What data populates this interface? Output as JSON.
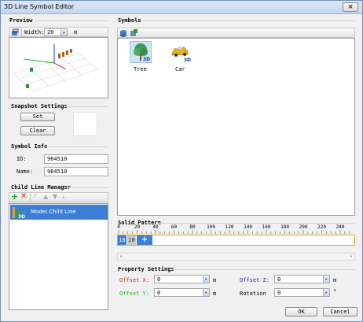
{
  "window": {
    "title": "3D Line Symbol Editor",
    "close_glyph": "×"
  },
  "preview": {
    "label": "Preview",
    "width_label": "Width:",
    "width_value": "20",
    "width_unit": "m"
  },
  "snapshot": {
    "label": "Snapshot Settings",
    "set_label": "Set",
    "clear_label": "Clear"
  },
  "symbol_info": {
    "label": "Symbol Info",
    "id_label": "ID:",
    "id_value": "964510",
    "name_label": "Name:",
    "name_value": "964510"
  },
  "child_line_manager": {
    "label": "Child Line Manager",
    "items": [
      {
        "label": "Model Child Line",
        "selected": true
      }
    ]
  },
  "symbols": {
    "label": "Symbols",
    "items": [
      {
        "label": "Tree",
        "badge": "3D",
        "icon": "tree-icon",
        "selected": true
      },
      {
        "label": "Car",
        "badge": "3D",
        "icon": "car-icon",
        "selected": false
      }
    ]
  },
  "solid_pattern": {
    "label": "Solid Pattern",
    "ruler_ticks": [
      "0",
      "20",
      "40",
      "60",
      "80",
      "100",
      "120",
      "140",
      "160",
      "180",
      "200",
      "220",
      "240"
    ],
    "cells": [
      "10",
      "10"
    ],
    "add_glyph": "+"
  },
  "property_settings": {
    "label": "Property Settings",
    "offset_x_label": "Offset X:",
    "offset_x_value": "0",
    "offset_y_label": "Offset Y:",
    "offset_y_value": "0",
    "offset_z_label": "Offset Z:",
    "offset_z_value": "0",
    "rotation_label": "Rotation",
    "rotation_value": "0",
    "unit_m": "m",
    "unit_deg": "°"
  },
  "footer": {
    "ok_label": "OK",
    "cancel_label": "Cancel"
  },
  "colors": {
    "offset_x": "#e02020",
    "offset_y": "#20b020",
    "offset_z": "#2020c0",
    "selection": "#3a7fd5"
  }
}
